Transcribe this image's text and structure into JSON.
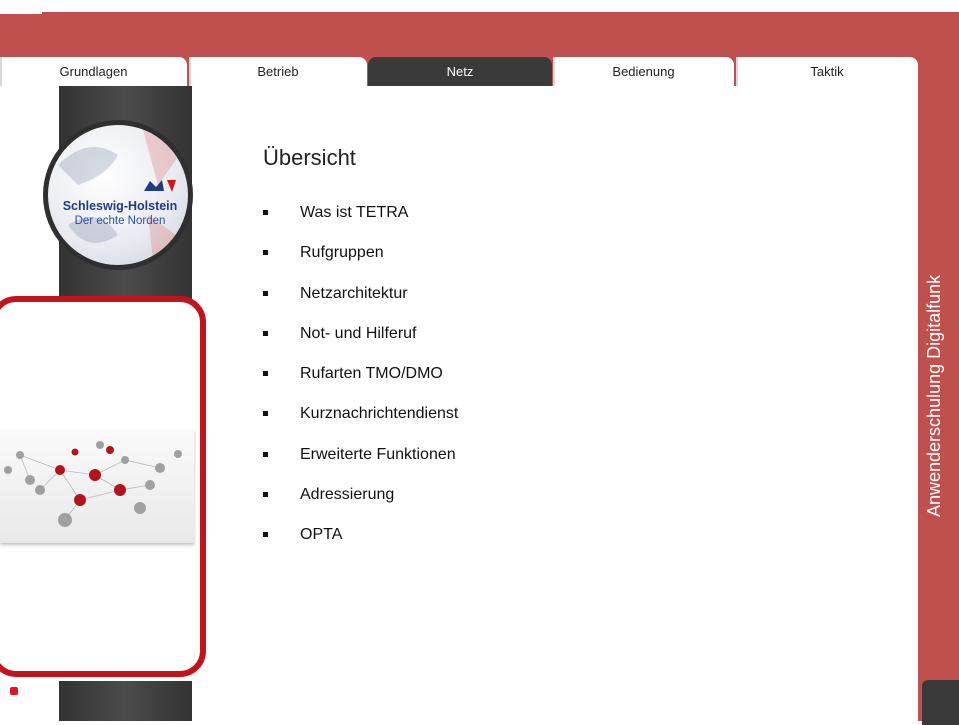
{
  "tabs": [
    {
      "label": "Grundlagen",
      "active": false
    },
    {
      "label": "Betrieb",
      "active": false
    },
    {
      "label": "Netz",
      "active": true
    },
    {
      "label": "Bedienung",
      "active": false
    },
    {
      "label": "Taktik",
      "active": false
    }
  ],
  "logo": {
    "line1": "Schleswig-Holstein",
    "line2": "Der echte Norden",
    "icon": "state-coat-of-arms-icon"
  },
  "main": {
    "title": "Übersicht",
    "items": [
      "Was ist TETRA",
      "Rufgruppen",
      "Netzarchitektur",
      "Not- und Hilferuf",
      "Rufarten TMO/DMO",
      "Kurznachrichtendienst",
      "Erweiterte Funktionen",
      "Adressierung",
      "OPTA"
    ]
  },
  "side": {
    "label": "Anwenderschulung Digitalfunk"
  },
  "colors": {
    "frame": "#c0504d",
    "accent_red": "#c0151c",
    "dark": "#3a3a3a"
  }
}
